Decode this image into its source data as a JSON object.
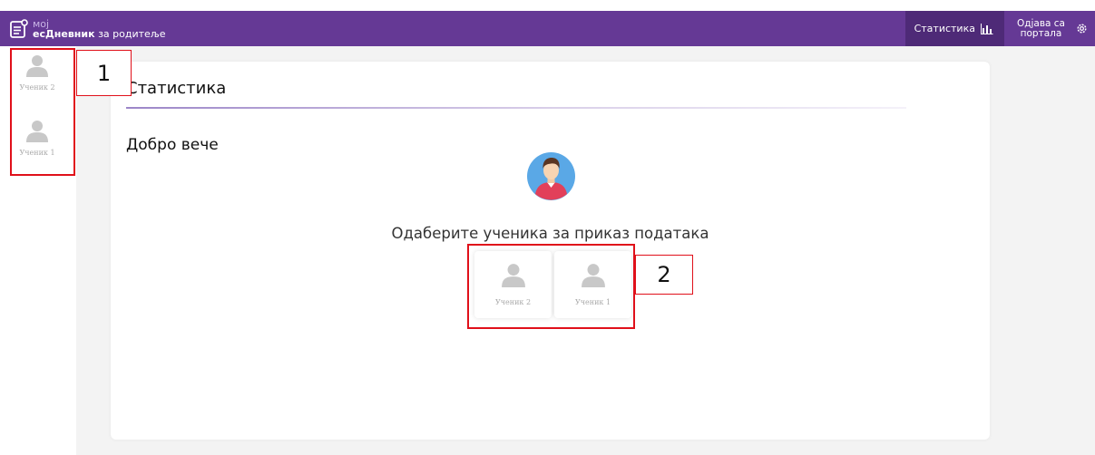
{
  "brand": {
    "moj": "мој",
    "name": "есДневник",
    "suffix": "за родитеље"
  },
  "topbar": {
    "statistics_label": "Статистика",
    "logout_line1": "Одјава са",
    "logout_line2": "портала"
  },
  "sidebar": {
    "students": [
      {
        "label": "Ученик 2"
      },
      {
        "label": "Ученик 1"
      }
    ]
  },
  "main": {
    "title": "Статистика",
    "greeting": "Добро вече",
    "prompt": "Одаберите ученика за приказ података",
    "students": [
      {
        "label": "Ученик 2"
      },
      {
        "label": "Ученик 1"
      }
    ]
  },
  "annotations": {
    "one": "1",
    "two": "2"
  },
  "colors": {
    "topbar": "#653995",
    "active_tab": "#4e2a77",
    "annotation": "#e0101a"
  }
}
